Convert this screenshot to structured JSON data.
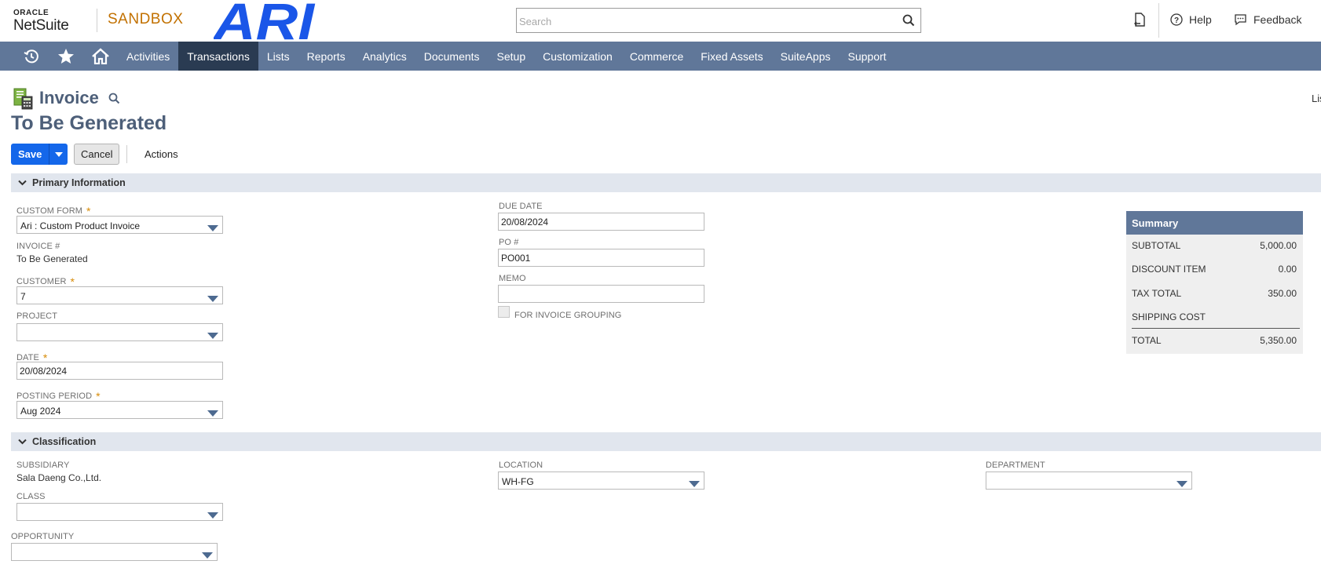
{
  "header": {
    "brand_small": "ORACLE",
    "brand_name": "NetSuite",
    "environment": "SANDBOX",
    "company_logo_text": "ARI",
    "search_placeholder": "Search",
    "help_label": "Help",
    "feedback_label": "Feedback"
  },
  "nav": {
    "items": [
      "Activities",
      "Transactions",
      "Lists",
      "Reports",
      "Analytics",
      "Documents",
      "Setup",
      "Customization",
      "Commerce",
      "Fixed Assets",
      "SuiteApps",
      "Support"
    ],
    "active": "Transactions"
  },
  "page": {
    "title": "Invoice",
    "record_name": "To Be Generated",
    "list_link": "List"
  },
  "toolbar": {
    "save_label": "Save",
    "cancel_label": "Cancel",
    "actions_label": "Actions"
  },
  "primary": {
    "section_title": "Primary Information",
    "custom_form_label": "CUSTOM FORM",
    "custom_form_value": "Ari : Custom Product Invoice",
    "invoice_no_label": "INVOICE #",
    "invoice_no_value": "To Be Generated",
    "customer_label": "CUSTOMER",
    "customer_value": "7",
    "project_label": "PROJECT",
    "project_value": "",
    "date_label": "DATE",
    "date_value": "20/08/2024",
    "posting_period_label": "POSTING PERIOD",
    "posting_period_value": "Aug 2024",
    "due_date_label": "DUE DATE",
    "due_date_value": "20/08/2024",
    "po_label": "PO #",
    "po_value": "PO001",
    "memo_label": "MEMO",
    "memo_value": "",
    "invoice_grouping_label": "FOR INVOICE GROUPING",
    "invoice_grouping_checked": false
  },
  "summary": {
    "title": "Summary",
    "rows": [
      {
        "label": "SUBTOTAL",
        "value": "5,000.00"
      },
      {
        "label": "DISCOUNT ITEM",
        "value": "0.00"
      },
      {
        "label": "TAX TOTAL",
        "value": "350.00"
      },
      {
        "label": "SHIPPING COST",
        "value": ""
      },
      {
        "label": "TOTAL",
        "value": "5,350.00"
      }
    ]
  },
  "classification": {
    "section_title": "Classification",
    "subsidiary_label": "SUBSIDIARY",
    "subsidiary_value": "Sala Daeng Co.,Ltd.",
    "class_label": "CLASS",
    "class_value": "",
    "location_label": "LOCATION",
    "location_value": "WH-FG",
    "department_label": "DEPARTMENT",
    "department_value": "",
    "opportunity_label": "OPPORTUNITY",
    "opportunity_value": ""
  },
  "colors": {
    "nav_bg": "#607799",
    "nav_active": "#2a3b52",
    "primary_button": "#1467ea",
    "sandbox": "#c27100",
    "title": "#4d5f79",
    "required": "#d78b07",
    "ari_logo": "#1a56e8"
  },
  "icons": [
    "recent-records-icon",
    "star-icon",
    "home-icon",
    "search-icon",
    "help-icon",
    "feedback-icon",
    "invoice-record-icon",
    "chevron-down-icon",
    "dropdown-arrow-icon"
  ]
}
